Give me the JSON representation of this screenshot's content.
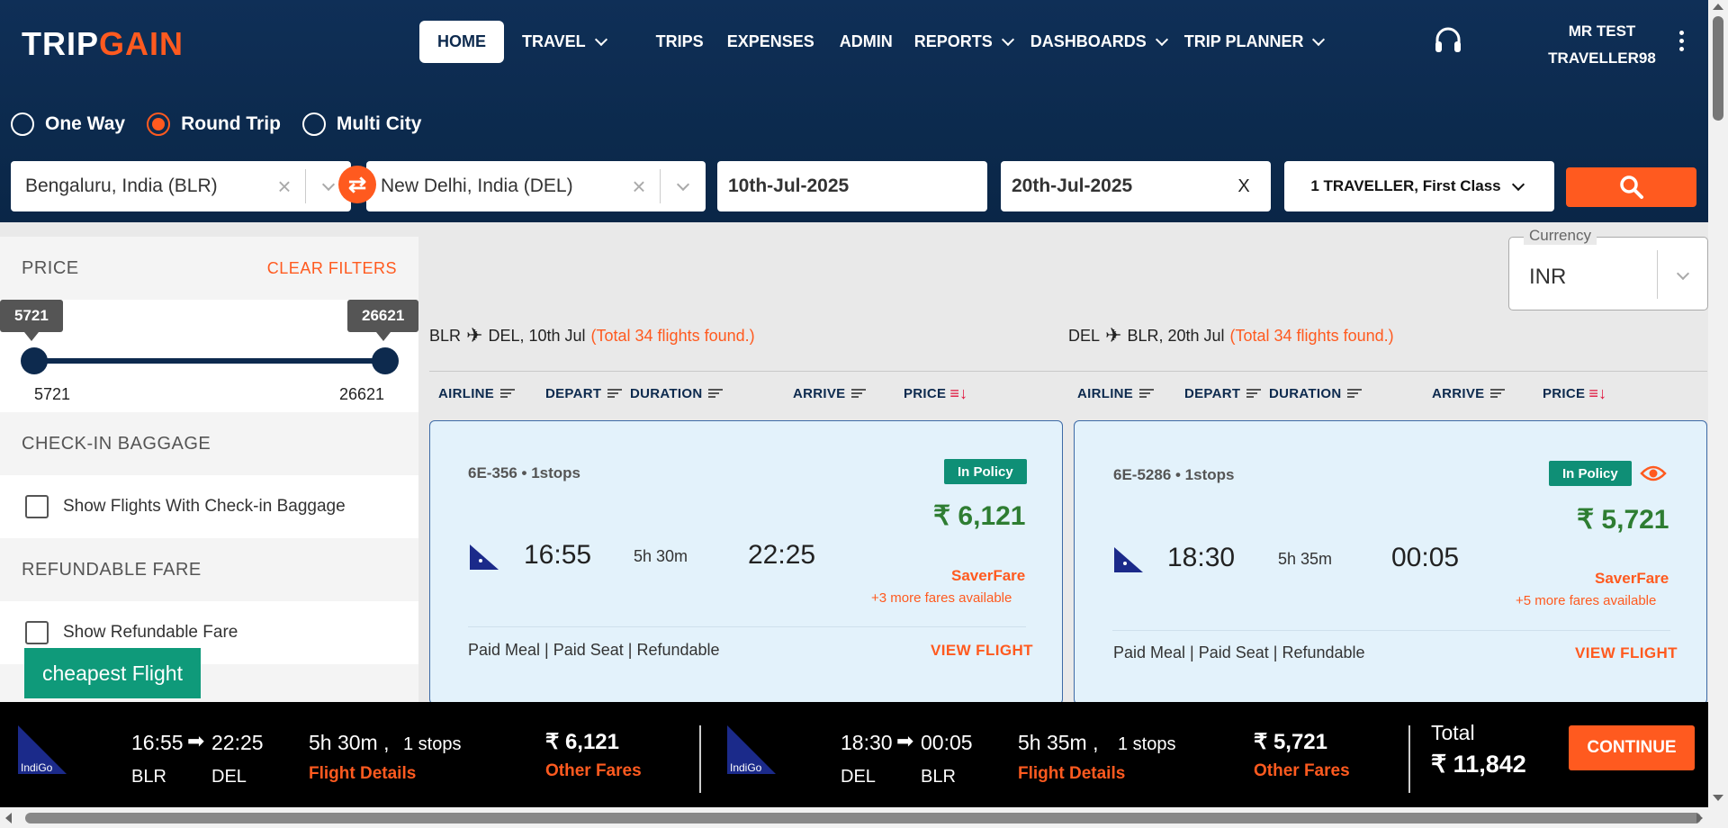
{
  "brand": {
    "trip": "TRIP",
    "gain": "GAIN"
  },
  "nav": {
    "home": "HOME",
    "travel": "TRAVEL",
    "trips": "TRIPS",
    "expenses": "EXPENSES",
    "admin": "ADMIN",
    "reports": "REPORTS",
    "dashboards": "DASHBOARDS",
    "trip_planner": "TRIP PLANNER"
  },
  "user": {
    "line1": "MR TEST",
    "line2": "TRAVELLER98"
  },
  "trip_types": {
    "one_way": "One Way",
    "round_trip": "Round Trip",
    "multi_city": "Multi City",
    "selected": "Round Trip"
  },
  "search": {
    "from": "Bengaluru, India (BLR)",
    "to": "New Delhi, India (DEL)",
    "depart_date": "10th-Jul-2025",
    "return_date": "20th-Jul-2025",
    "return_clear": "X",
    "travellers": "1 TRAVELLER, First Class"
  },
  "filters": {
    "price_title": "PRICE",
    "clear": "CLEAR FILTERS",
    "min": "5721",
    "max": "26621",
    "baggage_title": "CHECK-IN BAGGAGE",
    "baggage_label": "Show Flights With Check-in Baggage",
    "refund_title": "REFUNDABLE FARE",
    "refund_label": "Show Refundable Fare",
    "cheapest": "cheapest Flight"
  },
  "currency": {
    "label": "Currency",
    "value": "INR"
  },
  "outbound": {
    "route_from": "BLR",
    "route_to": "DEL, 10th Jul",
    "found": "(Total 34 flights found.)",
    "sort": {
      "airline": "AIRLINE",
      "depart": "DEPART",
      "duration": "DURATION",
      "arrive": "ARRIVE",
      "price": "PRICE"
    },
    "flight": {
      "code": "6E-356 • 1stops",
      "badge": "In Policy",
      "price": "₹ 6,121",
      "depart": "16:55",
      "duration": "5h 30m",
      "arrive": "22:25",
      "fare": "SaverFare",
      "more": "+3 more fares available",
      "features": "Paid Meal | Paid Seat | Refundable",
      "view": "VIEW FLIGHT"
    }
  },
  "return": {
    "route_from": "DEL",
    "route_to": "BLR, 20th Jul",
    "found": "(Total 34 flights found.)",
    "sort": {
      "airline": "AIRLINE",
      "depart": "DEPART",
      "duration": "DURATION",
      "arrive": "ARRIVE",
      "price": "PRICE"
    },
    "flight": {
      "code": "6E-5286 • 1stops",
      "badge": "In Policy",
      "price": "₹ 5,721",
      "depart": "18:30",
      "duration": "5h 35m",
      "arrive": "00:05",
      "fare": "SaverFare",
      "more": "+5 more fares available",
      "features": "Paid Meal | Paid Seat | Refundable",
      "view": "VIEW FLIGHT"
    }
  },
  "summary": {
    "out": {
      "dep": "16:55",
      "arr": "22:25",
      "from": "BLR",
      "to": "DEL",
      "dur": "5h 30m ,",
      "stops": "1 stops",
      "details": "Flight Details",
      "price": "₹ 6,121",
      "other": "Other Fares",
      "logo": "IndiGo"
    },
    "ret": {
      "dep": "18:30",
      "arr": "00:05",
      "from": "DEL",
      "to": "BLR",
      "dur": "5h 35m ,",
      "stops": "1 stops",
      "details": "Flight Details",
      "price": "₹ 5,721",
      "other": "Other Fares",
      "logo": "IndiGo"
    },
    "total_label": "Total",
    "total": "₹ 11,842",
    "continue": "CONTINUE"
  },
  "icons": {
    "support": "headset-icon",
    "menu": "kebab-menu-icon",
    "swap": "swap-icon",
    "search": "search-icon",
    "plane": "plane-icon",
    "eye": "eye-icon",
    "arrow": "arrow-right-icon"
  },
  "colors": {
    "primary": "#0d2a4e",
    "accent": "#ff5a1f",
    "policy": "#0f8f76",
    "price_green": "#2e7d32",
    "card_bg": "#e3f2fb"
  }
}
